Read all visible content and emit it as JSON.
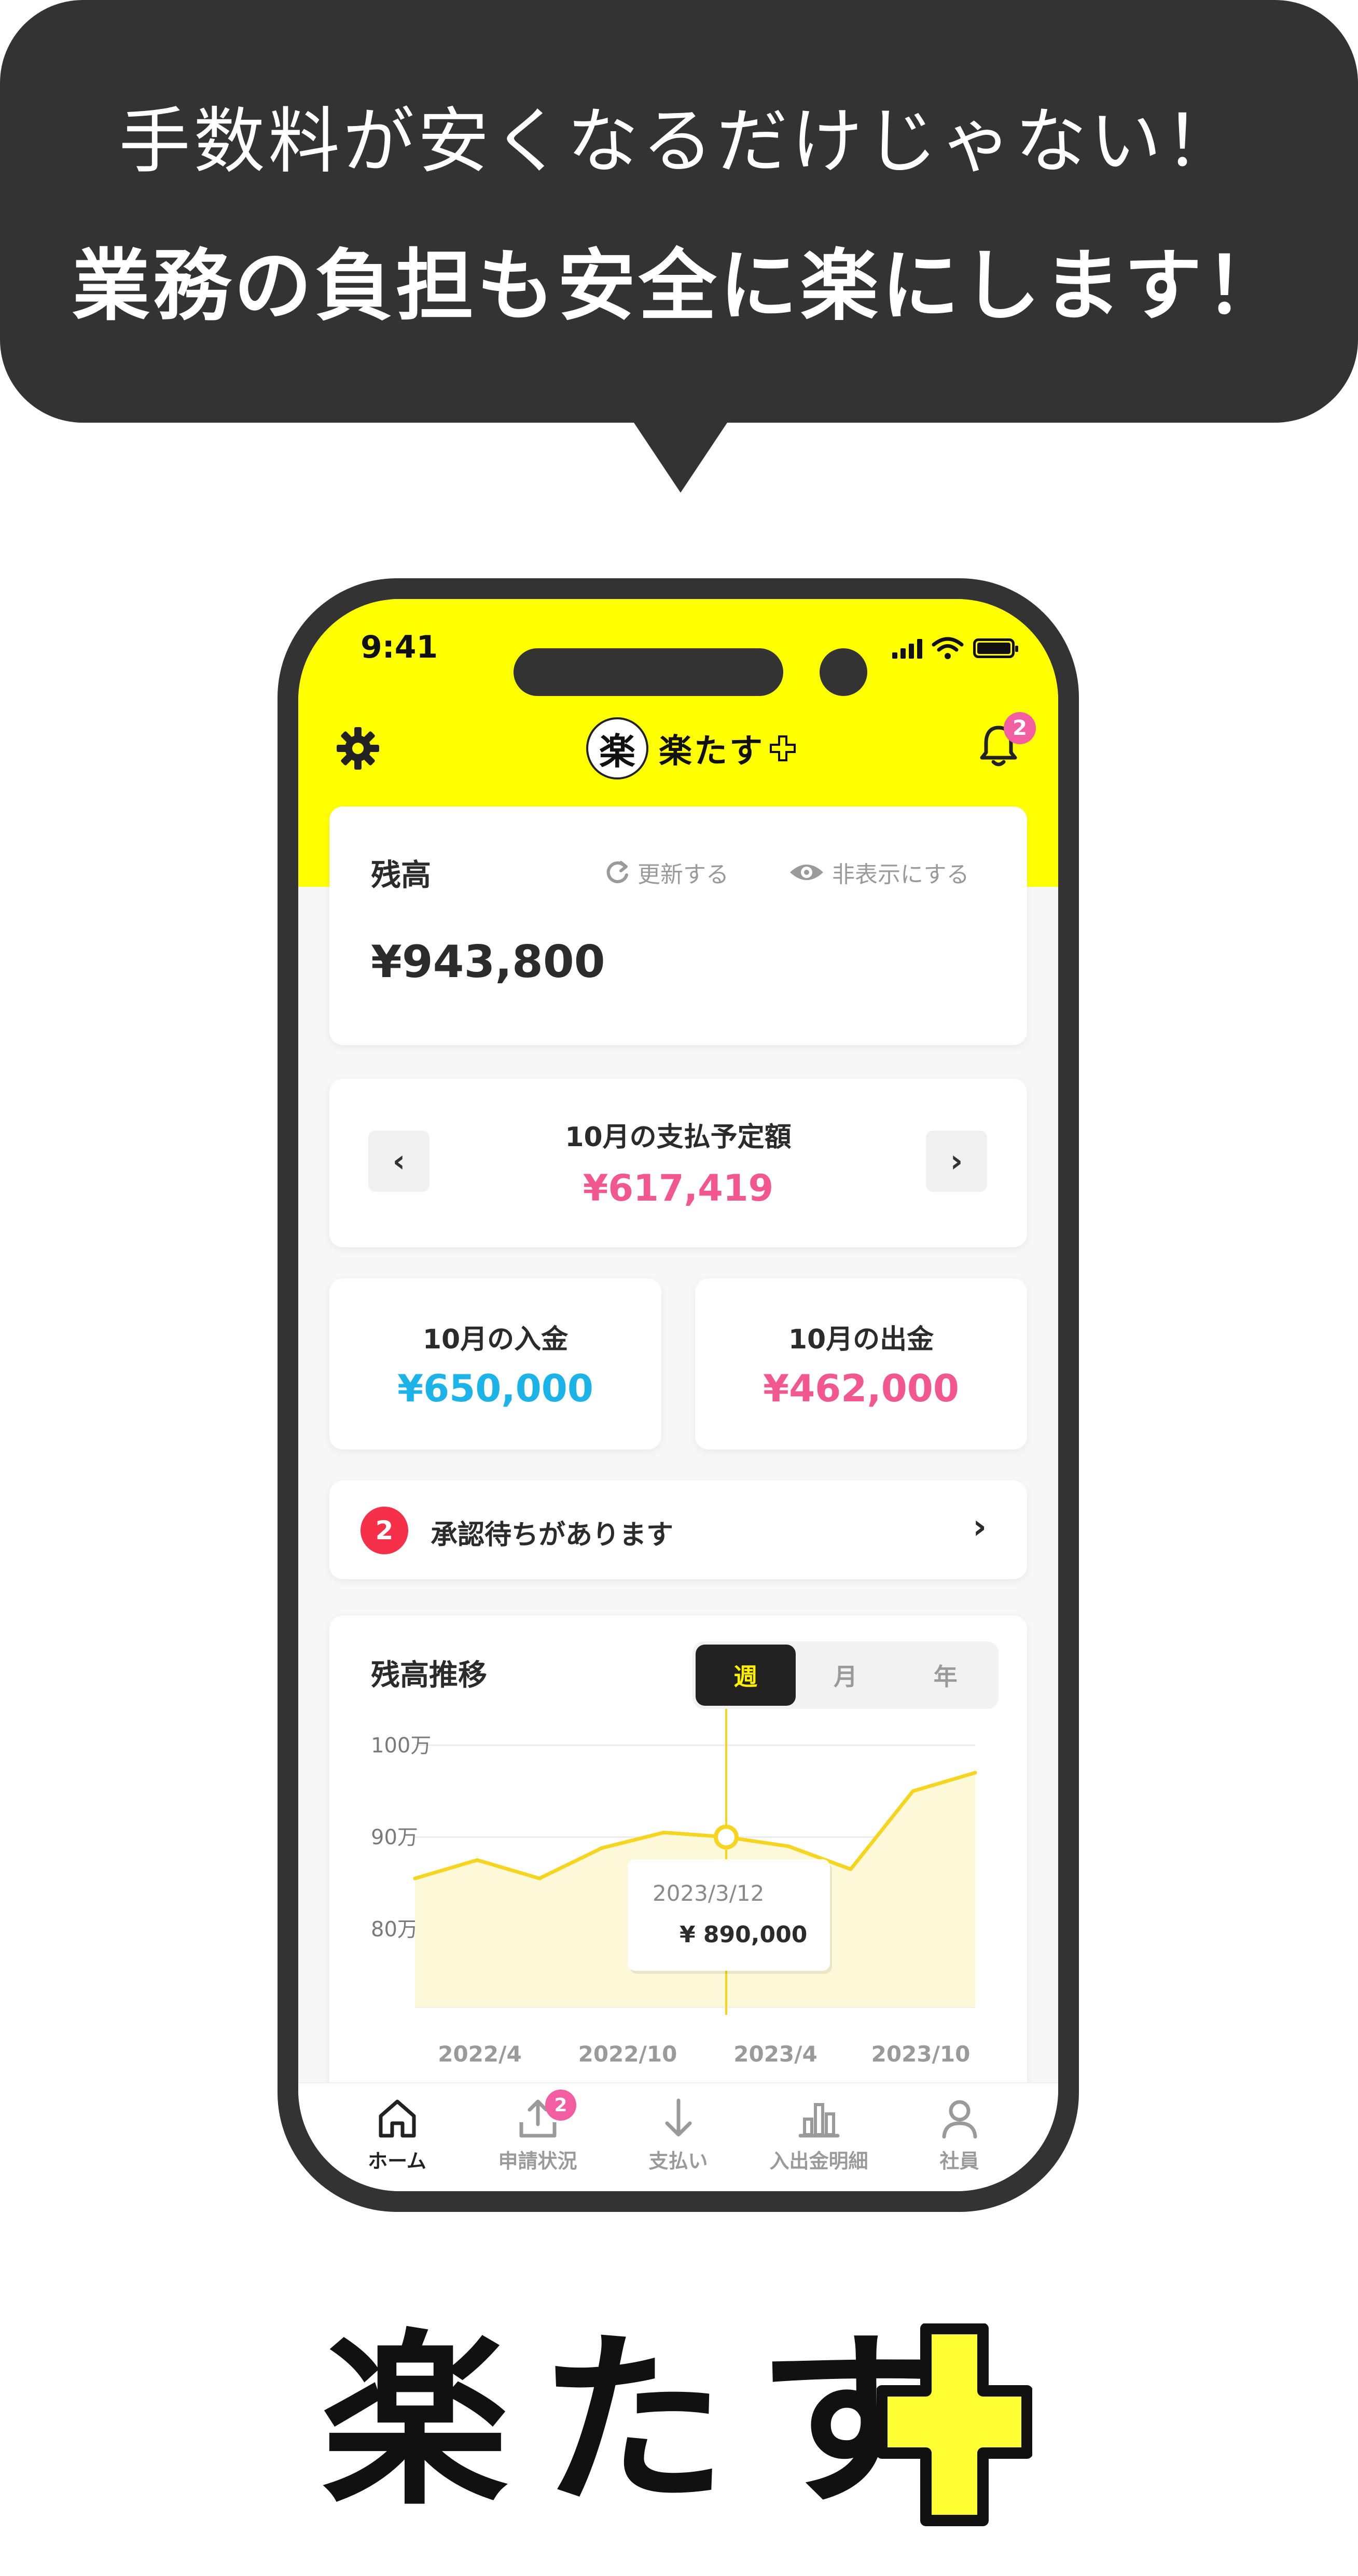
{
  "promo": {
    "line1": "手数料が安くなるだけじゃない！",
    "line2": "業務の負担も安全に楽にします！"
  },
  "status_bar": {
    "time": "9:41"
  },
  "app": {
    "logo_mark": "楽",
    "logo_text": "楽たす",
    "notification_count": "2"
  },
  "balance": {
    "label": "残高",
    "refresh_label": "更新する",
    "hide_label": "非表示にする",
    "amount": "¥943,800"
  },
  "scheduled_payment": {
    "label": "10月の支払予定額",
    "amount": "¥617,419",
    "prev_label": "‹",
    "next_label": "›"
  },
  "income": {
    "label": "10月の入金",
    "amount": "¥650,000"
  },
  "expense": {
    "label": "10月の出金",
    "amount": "¥462,000"
  },
  "approval": {
    "count": "2",
    "text": "承認待ちがあります",
    "chevron": "›"
  },
  "chart_data": {
    "type": "area",
    "title": "残高推移",
    "periods": [
      "週",
      "月",
      "年"
    ],
    "active_period": "週",
    "y_ticks": [
      {
        "value": 100,
        "label": "100万"
      },
      {
        "value": 90,
        "label": "90万"
      },
      {
        "value": 80,
        "label": "80万"
      }
    ],
    "x_ticks": [
      "2022/4",
      "2022/10",
      "2023/4",
      "2023/10"
    ],
    "ylim": [
      71.5,
      100
    ],
    "values": [
      85.5,
      87.5,
      85.5,
      88.8,
      90.5,
      90,
      89,
      86.5,
      95,
      97
    ],
    "highlight_index": 5,
    "tooltip": {
      "date": "2023/3/12",
      "value": "¥ 890,000"
    },
    "colors": {
      "line": "#f5d520",
      "fill": "#fdf9d8"
    }
  },
  "tabbar": {
    "items": [
      {
        "label": "ホーム",
        "icon": "home-icon"
      },
      {
        "label": "申請状況",
        "icon": "upload-icon",
        "badge": "2"
      },
      {
        "label": "支払い",
        "icon": "arrow-down-icon"
      },
      {
        "label": "入出金明細",
        "icon": "bar-chart-icon"
      },
      {
        "label": "社員",
        "icon": "person-icon"
      }
    ]
  },
  "brand": {
    "wordmark": "楽たす"
  },
  "colors": {
    "accent_yellow": "#ffff00",
    "pink": "#f2588f",
    "blue": "#1bb3e8",
    "dark": "#333333"
  }
}
